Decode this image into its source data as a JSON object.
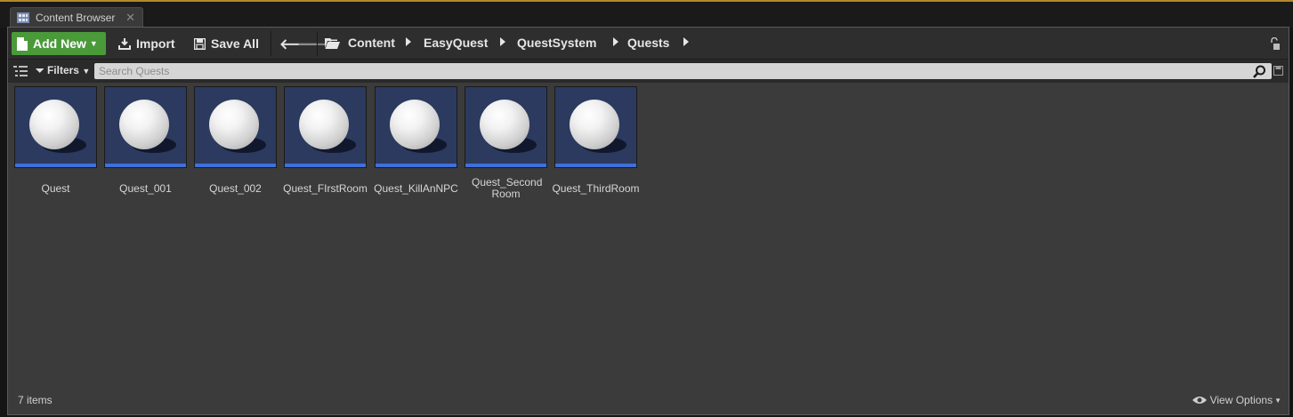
{
  "tab": {
    "label": "Content Browser",
    "close": "✕"
  },
  "toolbar": {
    "add_new": "Add New",
    "import": "Import",
    "save_all": "Save All"
  },
  "breadcrumb": [
    "Content",
    "EasyQuest",
    "QuestSystem",
    "Quests"
  ],
  "filters": {
    "label": "Filters"
  },
  "search": {
    "placeholder": "Search Quests"
  },
  "assets": [
    {
      "name": "Quest"
    },
    {
      "name": "Quest_001"
    },
    {
      "name": "Quest_002"
    },
    {
      "name": "Quest_FIrstRoom"
    },
    {
      "name": "Quest_KillAnNPC"
    },
    {
      "name": "Quest_Second Room"
    },
    {
      "name": "Quest_ThirdRoom"
    }
  ],
  "status": {
    "item_count": "7 items"
  },
  "view_options": {
    "label": "View Options"
  },
  "colors": {
    "accent_green": "#4a9a3a",
    "thumb_bg": "#2b3a5e",
    "thumb_bar": "#3f70d8",
    "top_accent": "#b08a2a"
  }
}
